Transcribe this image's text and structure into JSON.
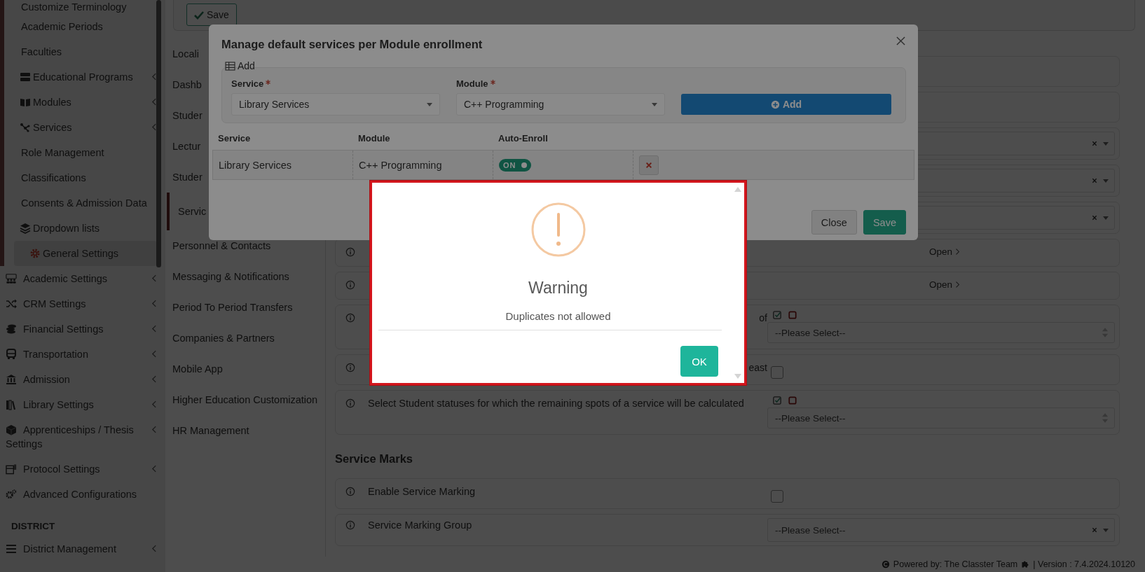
{
  "sidebar": {
    "items": [
      {
        "label": "Customize Terminology",
        "kind": "sub",
        "expandable": false,
        "selected": false
      },
      {
        "label": "Academic Periods",
        "kind": "sub",
        "expandable": false,
        "selected": false
      },
      {
        "label": "Faculties",
        "kind": "sub",
        "expandable": false,
        "selected": false
      },
      {
        "label": "Educational Programs",
        "kind": "sub",
        "expandable": true,
        "selected": false
      },
      {
        "label": "Modules",
        "kind": "sub",
        "expandable": true,
        "selected": false
      },
      {
        "label": "Services",
        "kind": "sub",
        "expandable": true,
        "selected": false
      },
      {
        "label": "Role Management",
        "kind": "sub",
        "expandable": false,
        "selected": false
      },
      {
        "label": "Classifications",
        "kind": "sub",
        "expandable": false,
        "selected": false
      },
      {
        "label": "Consents & Admission Data",
        "kind": "sub",
        "expandable": false,
        "selected": false
      },
      {
        "label": "Dropdown lists",
        "kind": "sub",
        "expandable": false,
        "selected": false
      },
      {
        "label": "General Settings",
        "kind": "sub",
        "expandable": false,
        "selected": true
      },
      {
        "label": "Academic Settings",
        "kind": "main",
        "expandable": true,
        "selected": false
      },
      {
        "label": "CRM Settings",
        "kind": "main",
        "expandable": true,
        "selected": false
      },
      {
        "label": "Financial Settings",
        "kind": "main",
        "expandable": true,
        "selected": false
      },
      {
        "label": "Transportation",
        "kind": "main",
        "expandable": true,
        "selected": false
      },
      {
        "label": "Admission",
        "kind": "main",
        "expandable": true,
        "selected": false
      },
      {
        "label": "Library Settings",
        "kind": "main",
        "expandable": true,
        "selected": false
      },
      {
        "label": "Apprenticeships / Thesis Settings",
        "kind": "main",
        "expandable": true,
        "selected": false
      },
      {
        "label": "Protocol Settings",
        "kind": "main",
        "expandable": true,
        "selected": false
      },
      {
        "label": "Advanced Configurations",
        "kind": "main",
        "expandable": false,
        "selected": false
      }
    ],
    "section_heading": "DISTRICT",
    "section_items": [
      {
        "label": "District Management",
        "expandable": true,
        "selected": false
      }
    ]
  },
  "toolbar": {
    "save_button": "Save"
  },
  "settings_nav": {
    "items": [
      {
        "label": "Locali",
        "selected": false
      },
      {
        "label": "Dashb",
        "selected": false
      },
      {
        "label": "Studer",
        "selected": false
      },
      {
        "label": "Lectur",
        "selected": false
      },
      {
        "label": "Studer",
        "selected": false
      },
      {
        "label": "Servic",
        "selected": true
      },
      {
        "label": "Personnel & Contacts",
        "selected": false
      },
      {
        "label": "Messaging & Notifications",
        "selected": false
      },
      {
        "label": "Period To Period Transfers",
        "selected": false
      },
      {
        "label": "Companies & Partners",
        "selected": false
      },
      {
        "label": "Mobile App",
        "selected": false
      },
      {
        "label": "Higher Education Customization",
        "selected": false
      },
      {
        "label": "HR Management",
        "selected": false
      }
    ]
  },
  "settings": {
    "rows": [
      {
        "kind": "empty",
        "info": false
      },
      {
        "kind": "empty",
        "info": false
      },
      {
        "kind": "select",
        "info": false,
        "clearable": true
      },
      {
        "kind": "select",
        "info": false,
        "clearable": true
      },
      {
        "kind": "select",
        "info": false,
        "clearable": true
      },
      {
        "kind": "link",
        "info": true,
        "link": "Open"
      },
      {
        "kind": "link",
        "info": true,
        "link": "Open"
      },
      {
        "kind": "multiselect",
        "info": true,
        "label": "of",
        "label_clipped": true,
        "placeholder": "--Please Select--"
      },
      {
        "kind": "checkbox",
        "info": true,
        "label": "east",
        "label_clipped": true,
        "checked": false
      },
      {
        "kind": "multiselect",
        "info": true,
        "label": "Select Student statuses for which the remaining spots of a service will be calculated",
        "label_clipped": false,
        "placeholder": "--Please Select--"
      }
    ],
    "section": {
      "heading": "Service Marks",
      "rows": [
        {
          "kind": "checkbox",
          "info": true,
          "label": "Enable Service Marking",
          "label_clipped": false,
          "checked": false
        },
        {
          "kind": "select",
          "info": true,
          "label": "Service Marking Group",
          "label_clipped": false,
          "placeholder": "--Please Select--",
          "clearable": true
        }
      ]
    }
  },
  "footer": {
    "powered_by": "Powered by: The Classter Team",
    "version": "| Version : 7.4.2024.10120"
  },
  "modal": {
    "title": "Manage default services per Module enrollment",
    "add_section": {
      "legend": "Add",
      "fields": [
        {
          "label": "Service",
          "required": true,
          "value": "Library Services"
        },
        {
          "label": "Module",
          "required": true,
          "value": "C++ Programming"
        }
      ],
      "button": "Add"
    },
    "table": {
      "columns": [
        "Service",
        "Module",
        "Auto-Enroll"
      ],
      "rows": [
        {
          "service": "Library Services",
          "module": "C++ Programming",
          "auto_enroll": {
            "on": true,
            "label": "ON"
          }
        }
      ]
    },
    "buttons": [
      {
        "label": "Close",
        "kind": "secondary"
      },
      {
        "label": "Save",
        "kind": "primary"
      }
    ]
  },
  "alert": {
    "title": "Warning",
    "message": "Duplicates not allowed",
    "button": "OK"
  }
}
